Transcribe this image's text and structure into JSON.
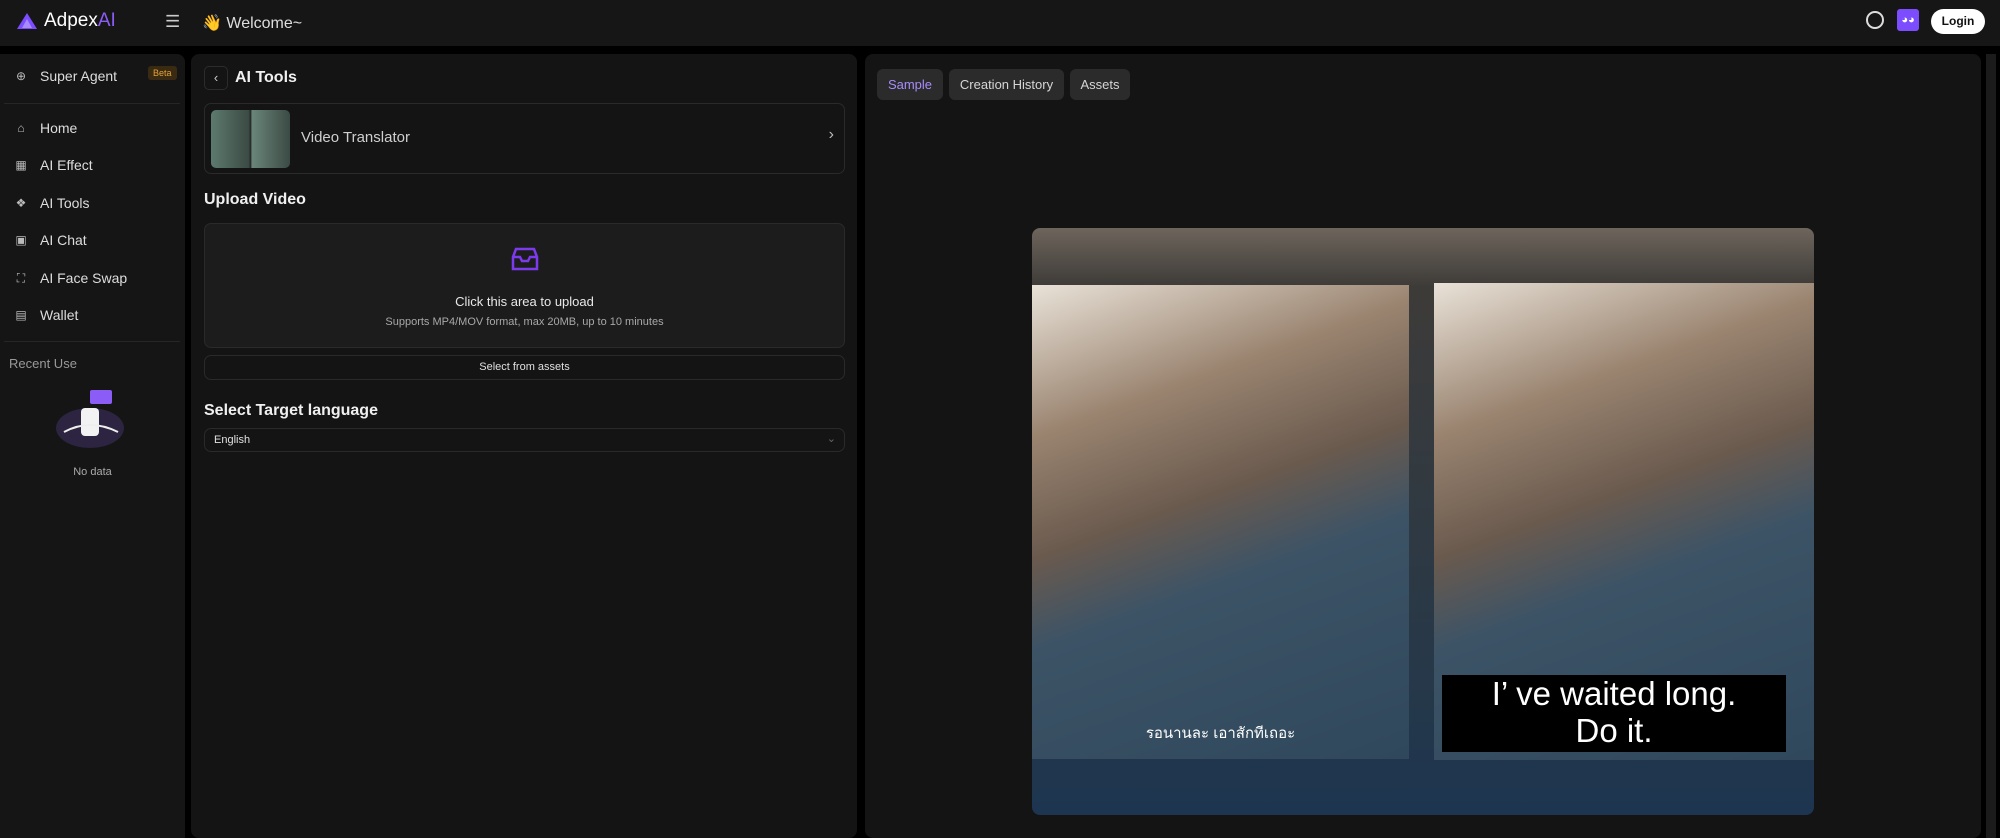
{
  "header": {
    "logo_text": "Adpex",
    "logo_ai": "AI",
    "welcome": "Welcome~",
    "login": "Login"
  },
  "sidebar": {
    "super_agent": "Super Agent",
    "beta": "Beta",
    "items": [
      {
        "label": "Home"
      },
      {
        "label": "AI Effect"
      },
      {
        "label": "AI Tools"
      },
      {
        "label": "AI Chat"
      },
      {
        "label": "AI Face Swap"
      },
      {
        "label": "Wallet"
      }
    ],
    "recent_use": "Recent Use",
    "no_data": "No data"
  },
  "main": {
    "title": "AI Tools",
    "tool_name": "Video Translator",
    "upload_heading": "Upload Video",
    "upload_prompt": "Click this area to upload",
    "upload_hint": "Supports MP4/MOV format, max 20MB, up to 10 minutes",
    "select_assets": "Select from assets",
    "lang_heading": "Select Target language",
    "lang_value": "English"
  },
  "right": {
    "tabs": [
      {
        "label": "Sample"
      },
      {
        "label": "Creation History"
      },
      {
        "label": "Assets"
      }
    ],
    "original_subtitle": "รอนานละ เอาสักทีเถอะ",
    "translated_line1": "I’ ve waited long.",
    "translated_line2": "Do it."
  },
  "colors": {
    "accent": "#8b5cf6",
    "beta": "#e3a23a"
  }
}
